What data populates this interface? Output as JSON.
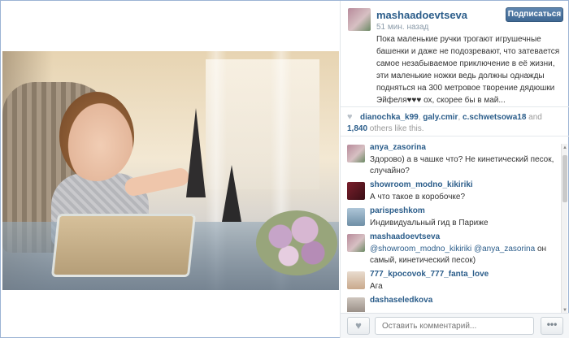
{
  "post": {
    "owner": "mashaadoevtseva",
    "time": "51 мин. назад",
    "follow_label": "Подписаться",
    "caption": "Пока маленькие ручки трогают игрушечные башенки и даже не подозревают, что затевается самое незабываемое приключение в её жизни, эти маленькие ножки ведь должны однажды подняться на 300 метровое творение дядюшки Эйфеля♥♥♥ ох, скорее бы в май..."
  },
  "likes": {
    "users": [
      "dianochka_k99",
      "galy.cmir",
      "c.schwetsowa18"
    ],
    "separator1": ", ",
    "separator2": " and ",
    "count": "1,840",
    "suffix": " others like this."
  },
  "comments": [
    {
      "user": "anya_zasorina",
      "text": "Здорово) а в чашке что? Не кинетический песок, случайно?"
    },
    {
      "user": "showroom_modno_kikiriki",
      "text": "А что такое в коробочке?"
    },
    {
      "user": "parispeshkom",
      "text": "Индивидуальный гид в Париже"
    },
    {
      "user": "mashaadoevtseva",
      "mention": "@showroom_modno_kikiriki @anya_zasorina",
      "text": " он самый, кинетический песок)"
    },
    {
      "user": "777_kpocovok_777_fanta_love",
      "text": "Ага"
    },
    {
      "user": "dashaseledkova",
      "text": ""
    }
  ],
  "footer": {
    "comment_placeholder": "Оставить комментарий...",
    "more_label": "•••"
  },
  "icons": {
    "heart": "heart-icon",
    "more": "more-dots-icon"
  },
  "colors": {
    "username": "#2b5d8a",
    "follow_button": "#3f6893",
    "frame_border": "#9cb3d4"
  }
}
